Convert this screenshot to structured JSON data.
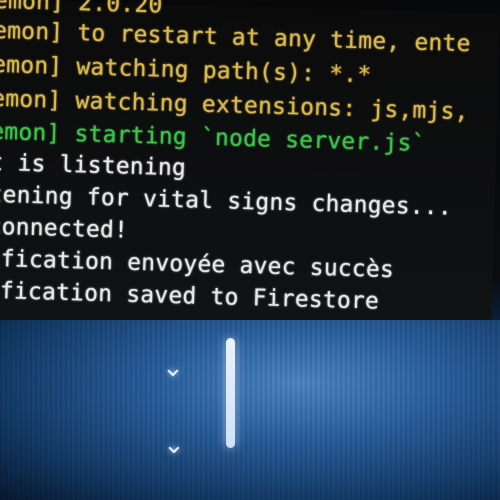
{
  "colors": {
    "nodemon_yellow": "#d9b84c",
    "green": "#3ec14a",
    "white": "#e8e8e8"
  },
  "terminal": {
    "lines": [
      {
        "text": "emon] 2.0.20",
        "color": "#d9b84c"
      },
      {
        "text": "emon] to restart at any time, ente",
        "color": "#d9b84c"
      },
      {
        "text": "emon] watching path(s): *.*",
        "color": "#d9b84c"
      },
      {
        "text": "emon] watching extensions: js,mjs,",
        "color": "#d9b84c"
      },
      {
        "text": "emon] starting `node server.js`",
        "color": "#3ec14a"
      },
      {
        "text": "t is listening",
        "color": "#e8e8e8"
      },
      {
        "text": "tening for vital signs changes...",
        "color": "#e8e8e8"
      },
      {
        "text": "connected!",
        "color": "#e8e8e8"
      },
      {
        "text": "ification envoyée avec succès",
        "color": "#e8e8e8"
      },
      {
        "text": "ification saved to Firestore",
        "color": "#e8e8e8"
      }
    ]
  },
  "desktop": {
    "icons": [
      "chevron-down-icon",
      "chevron-down-icon"
    ],
    "chevron_glyph": "⌄"
  }
}
